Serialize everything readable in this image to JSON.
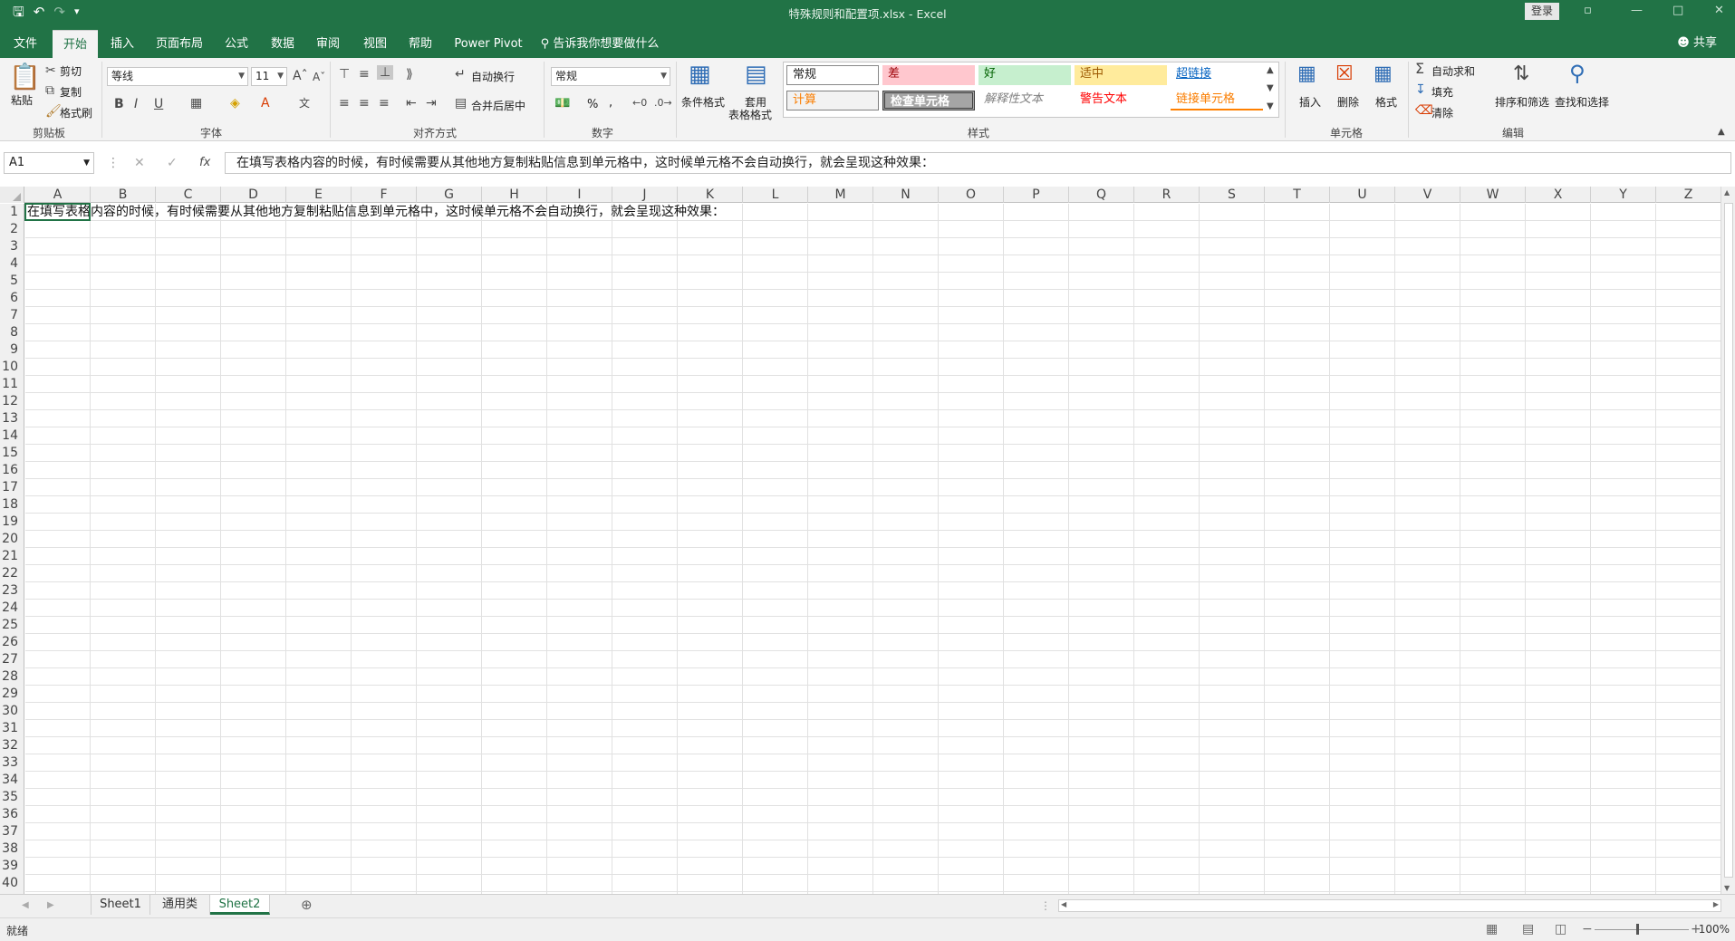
{
  "titlebar": {
    "doc_title": "特殊规则和配置项.xlsx  -  Excel",
    "login": "登录"
  },
  "tabs": [
    "文件",
    "开始",
    "插入",
    "页面布局",
    "公式",
    "数据",
    "审阅",
    "视图",
    "帮助",
    "Power Pivot"
  ],
  "tell_me": "告诉我你想要做什么",
  "share": "共享",
  "ribbon": {
    "clipboard": {
      "paste": "粘贴",
      "cut": "剪切",
      "copy": "复制",
      "format_painter": "格式刷",
      "label": "剪贴板"
    },
    "font": {
      "name": "等线",
      "size": "11",
      "label": "字体"
    },
    "alignment": {
      "wrap": "自动换行",
      "merge": "合并后居中",
      "label": "对齐方式"
    },
    "number": {
      "format": "常规",
      "percent": "%",
      "comma": ",",
      "label": "数字"
    },
    "styles": {
      "cond_format": "条件格式",
      "table_format_1": "套用",
      "table_format_2": "表格格式",
      "cells": [
        "常规",
        "差",
        "好",
        "适中",
        "超链接",
        "计算",
        "检查单元格",
        "解释性文本",
        "警告文本",
        "链接单元格"
      ],
      "label": "样式"
    },
    "cells_group": {
      "insert": "插入",
      "delete": "删除",
      "format": "格式",
      "label": "单元格"
    },
    "editing": {
      "autosum": "自动求和",
      "fill": "填充",
      "clear": "清除",
      "sort": "排序和筛选",
      "find": "查找和选择",
      "label": "编辑"
    }
  },
  "namebox": "A1",
  "formula_value": "在填写表格内容的时候，有时候需要从其他地方复制粘贴信息到单元格中，这时候单元格不会自动换行，就会呈现这种效果：",
  "columns": [
    "A",
    "B",
    "C",
    "D",
    "E",
    "F",
    "G",
    "H",
    "I",
    "J",
    "K",
    "L",
    "M",
    "N",
    "O",
    "P",
    "Q",
    "R",
    "S",
    "T",
    "U",
    "V",
    "W",
    "X",
    "Y",
    "Z"
  ],
  "rows": [
    "1",
    "2",
    "3",
    "4",
    "5",
    "6",
    "7",
    "8",
    "9",
    "10",
    "11",
    "12",
    "13",
    "14",
    "15",
    "16",
    "17",
    "18",
    "19",
    "20",
    "21",
    "22",
    "23",
    "24",
    "25",
    "26",
    "27",
    "28",
    "29",
    "30",
    "31",
    "32",
    "33",
    "34",
    "35",
    "36",
    "37",
    "38",
    "39",
    "40"
  ],
  "cell_a1": "在填写表格内容的时候，有时候需要从其他地方复制粘贴信息到单元格中，这时候单元格不会自动换行，就会呈现这种效果：",
  "sheets": [
    "Sheet1",
    "通用类",
    "Sheet2"
  ],
  "status": "就绪",
  "zoom": "100%",
  "colors": {
    "accent": "#217346"
  }
}
